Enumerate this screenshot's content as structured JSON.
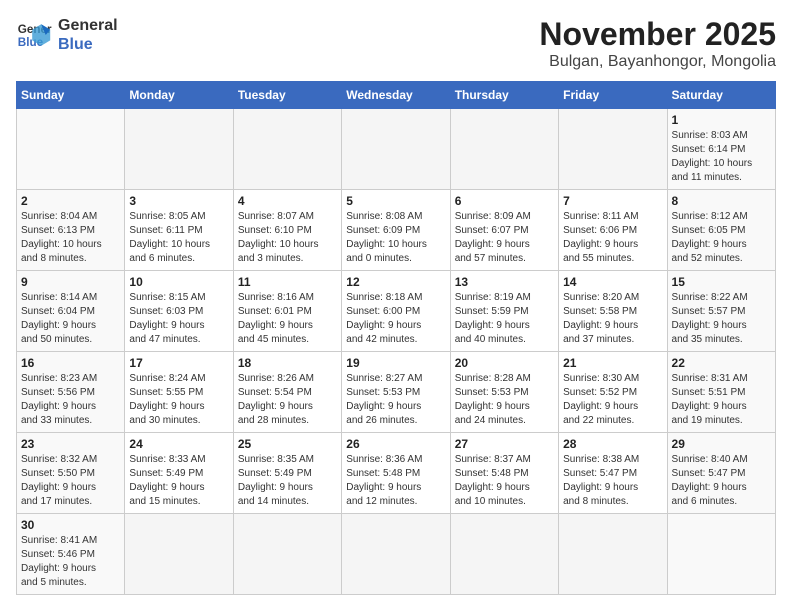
{
  "logo": {
    "line1": "General",
    "line2": "Blue"
  },
  "title": "November 2025",
  "subtitle": "Bulgan, Bayanhongor, Mongolia",
  "days_of_week": [
    "Sunday",
    "Monday",
    "Tuesday",
    "Wednesday",
    "Thursday",
    "Friday",
    "Saturday"
  ],
  "weeks": [
    [
      {
        "day": "",
        "info": ""
      },
      {
        "day": "",
        "info": ""
      },
      {
        "day": "",
        "info": ""
      },
      {
        "day": "",
        "info": ""
      },
      {
        "day": "",
        "info": ""
      },
      {
        "day": "",
        "info": ""
      },
      {
        "day": "1",
        "info": "Sunrise: 8:03 AM\nSunset: 6:14 PM\nDaylight: 10 hours\nand 11 minutes."
      }
    ],
    [
      {
        "day": "2",
        "info": "Sunrise: 8:04 AM\nSunset: 6:13 PM\nDaylight: 10 hours\nand 8 minutes."
      },
      {
        "day": "3",
        "info": "Sunrise: 8:05 AM\nSunset: 6:11 PM\nDaylight: 10 hours\nand 6 minutes."
      },
      {
        "day": "4",
        "info": "Sunrise: 8:07 AM\nSunset: 6:10 PM\nDaylight: 10 hours\nand 3 minutes."
      },
      {
        "day": "5",
        "info": "Sunrise: 8:08 AM\nSunset: 6:09 PM\nDaylight: 10 hours\nand 0 minutes."
      },
      {
        "day": "6",
        "info": "Sunrise: 8:09 AM\nSunset: 6:07 PM\nDaylight: 9 hours\nand 57 minutes."
      },
      {
        "day": "7",
        "info": "Sunrise: 8:11 AM\nSunset: 6:06 PM\nDaylight: 9 hours\nand 55 minutes."
      },
      {
        "day": "8",
        "info": "Sunrise: 8:12 AM\nSunset: 6:05 PM\nDaylight: 9 hours\nand 52 minutes."
      }
    ],
    [
      {
        "day": "9",
        "info": "Sunrise: 8:14 AM\nSunset: 6:04 PM\nDaylight: 9 hours\nand 50 minutes."
      },
      {
        "day": "10",
        "info": "Sunrise: 8:15 AM\nSunset: 6:03 PM\nDaylight: 9 hours\nand 47 minutes."
      },
      {
        "day": "11",
        "info": "Sunrise: 8:16 AM\nSunset: 6:01 PM\nDaylight: 9 hours\nand 45 minutes."
      },
      {
        "day": "12",
        "info": "Sunrise: 8:18 AM\nSunset: 6:00 PM\nDaylight: 9 hours\nand 42 minutes."
      },
      {
        "day": "13",
        "info": "Sunrise: 8:19 AM\nSunset: 5:59 PM\nDaylight: 9 hours\nand 40 minutes."
      },
      {
        "day": "14",
        "info": "Sunrise: 8:20 AM\nSunset: 5:58 PM\nDaylight: 9 hours\nand 37 minutes."
      },
      {
        "day": "15",
        "info": "Sunrise: 8:22 AM\nSunset: 5:57 PM\nDaylight: 9 hours\nand 35 minutes."
      }
    ],
    [
      {
        "day": "16",
        "info": "Sunrise: 8:23 AM\nSunset: 5:56 PM\nDaylight: 9 hours\nand 33 minutes."
      },
      {
        "day": "17",
        "info": "Sunrise: 8:24 AM\nSunset: 5:55 PM\nDaylight: 9 hours\nand 30 minutes."
      },
      {
        "day": "18",
        "info": "Sunrise: 8:26 AM\nSunset: 5:54 PM\nDaylight: 9 hours\nand 28 minutes."
      },
      {
        "day": "19",
        "info": "Sunrise: 8:27 AM\nSunset: 5:53 PM\nDaylight: 9 hours\nand 26 minutes."
      },
      {
        "day": "20",
        "info": "Sunrise: 8:28 AM\nSunset: 5:53 PM\nDaylight: 9 hours\nand 24 minutes."
      },
      {
        "day": "21",
        "info": "Sunrise: 8:30 AM\nSunset: 5:52 PM\nDaylight: 9 hours\nand 22 minutes."
      },
      {
        "day": "22",
        "info": "Sunrise: 8:31 AM\nSunset: 5:51 PM\nDaylight: 9 hours\nand 19 minutes."
      }
    ],
    [
      {
        "day": "23",
        "info": "Sunrise: 8:32 AM\nSunset: 5:50 PM\nDaylight: 9 hours\nand 17 minutes."
      },
      {
        "day": "24",
        "info": "Sunrise: 8:33 AM\nSunset: 5:49 PM\nDaylight: 9 hours\nand 15 minutes."
      },
      {
        "day": "25",
        "info": "Sunrise: 8:35 AM\nSunset: 5:49 PM\nDaylight: 9 hours\nand 14 minutes."
      },
      {
        "day": "26",
        "info": "Sunrise: 8:36 AM\nSunset: 5:48 PM\nDaylight: 9 hours\nand 12 minutes."
      },
      {
        "day": "27",
        "info": "Sunrise: 8:37 AM\nSunset: 5:48 PM\nDaylight: 9 hours\nand 10 minutes."
      },
      {
        "day": "28",
        "info": "Sunrise: 8:38 AM\nSunset: 5:47 PM\nDaylight: 9 hours\nand 8 minutes."
      },
      {
        "day": "29",
        "info": "Sunrise: 8:40 AM\nSunset: 5:47 PM\nDaylight: 9 hours\nand 6 minutes."
      }
    ],
    [
      {
        "day": "30",
        "info": "Sunrise: 8:41 AM\nSunset: 5:46 PM\nDaylight: 9 hours\nand 5 minutes."
      },
      {
        "day": "",
        "info": ""
      },
      {
        "day": "",
        "info": ""
      },
      {
        "day": "",
        "info": ""
      },
      {
        "day": "",
        "info": ""
      },
      {
        "day": "",
        "info": ""
      },
      {
        "day": "",
        "info": ""
      }
    ]
  ]
}
